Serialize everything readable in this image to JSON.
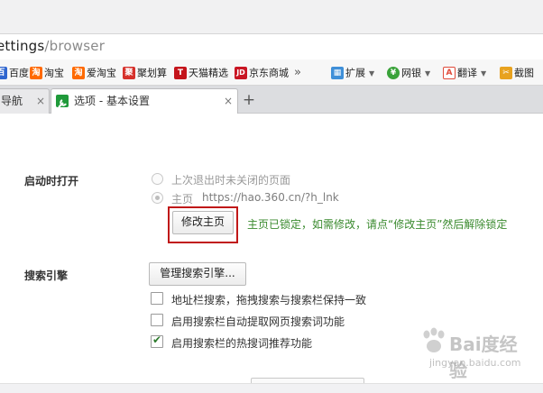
{
  "address_bar": {
    "url_host": "ettings",
    "url_path": "/browser"
  },
  "bookmarks": [
    {
      "label": "百度",
      "icon": "baidu-icon",
      "color": "#2f66cf",
      "glyph": "百"
    },
    {
      "label": "淘宝",
      "icon": "taobao-icon",
      "color": "#ff6a00",
      "glyph": "淘"
    },
    {
      "label": "爱淘宝",
      "icon": "aitaobao-icon",
      "color": "#ff6a00",
      "glyph": "淘"
    },
    {
      "label": "聚划算",
      "icon": "juhuasuan-icon",
      "color": "#d6312b",
      "glyph": "聚"
    },
    {
      "label": "天猫精选",
      "icon": "tmall-icon",
      "color": "#c4141b",
      "glyph": "T"
    },
    {
      "label": "京东商城",
      "icon": "jd-icon",
      "color": "#c91623",
      "glyph": "JD"
    },
    {
      "label": "»",
      "icon": "more-bookmarks-icon"
    }
  ],
  "toolbar": [
    {
      "label": "扩展",
      "icon": "extensions-icon",
      "color": "#3f8fd8"
    },
    {
      "label": "网银",
      "icon": "ebank-icon",
      "color": "#3aa33a"
    },
    {
      "label": "翻译",
      "icon": "translate-icon",
      "color": "#e04b3b"
    },
    {
      "label": "截图",
      "icon": "screenshot-icon",
      "color": "#e8a21f"
    }
  ],
  "tabs": [
    {
      "label": "导航",
      "active": false
    },
    {
      "label": "选项 - 基本设置",
      "active": true
    }
  ],
  "new_tab_label": "+",
  "close_glyph": "×",
  "startup": {
    "section_label": "启动时打开",
    "option_restore": "上次退出时未关闭的页面",
    "option_homepage": "主页",
    "homepage_url": "https://hao.360.cn/?h_lnk",
    "modify_button": "修改主页",
    "locked_notice": "主页已锁定，如需修改，请点“修改主页”然后解除锁定"
  },
  "search": {
    "section_label": "搜索引擎",
    "manage_button": "管理搜索引擎...",
    "options": [
      {
        "label": "地址栏搜索，拖拽搜索与搜索栏保持一致",
        "checked": false
      },
      {
        "label": "启用搜索栏自动提取网页搜索词功能",
        "checked": false
      },
      {
        "label": "启用搜索栏的热搜词推荐功能",
        "checked": true
      }
    ]
  },
  "watermark": {
    "main": "Bai度经验",
    "sub": "jingyan.baidu.com"
  }
}
